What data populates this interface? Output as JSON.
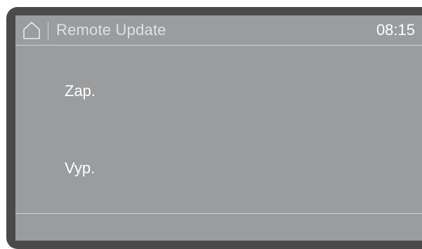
{
  "header": {
    "home_icon": "home-icon",
    "title": "Remote Update",
    "time": "08:15"
  },
  "options": [
    {
      "label": "Zap."
    },
    {
      "label": "Vyp."
    }
  ],
  "colors": {
    "bezel": "#4a4a4a",
    "screen_background": "#9b9c9e",
    "text": "#ffffff",
    "divider": "#d0d1d2"
  }
}
